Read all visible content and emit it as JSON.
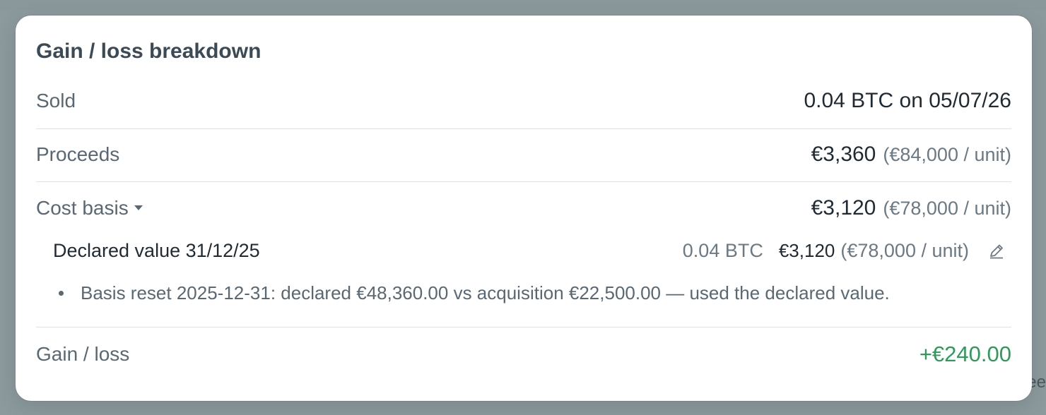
{
  "modal": {
    "title": "Gain / loss breakdown",
    "rows": {
      "sold": {
        "label": "Sold",
        "value": "0.04 BTC on 05/07/26"
      },
      "proceeds": {
        "label": "Proceeds",
        "value": "€3,360",
        "per_unit": "(€84,000 / unit)"
      },
      "cost_basis": {
        "label": "Cost basis",
        "value": "€3,120",
        "per_unit": "(€78,000 / unit)",
        "expand_icon": "caret-down-icon"
      },
      "lot": {
        "label": "Declared value 31/12/25",
        "quantity": "0.04 BTC",
        "value": "€3,120",
        "per_unit": "(€78,000 / unit)",
        "edit_icon": "pencil-icon"
      },
      "note": "Basis reset 2025-12-31: declared €48,360.00 vs acquisition €22,500.00 — used the declared value.",
      "gain_loss": {
        "label": "Gain / loss",
        "value": "+€240.00",
        "color": "#2f9a5a"
      }
    }
  },
  "background": {
    "peek_text": "ee"
  }
}
